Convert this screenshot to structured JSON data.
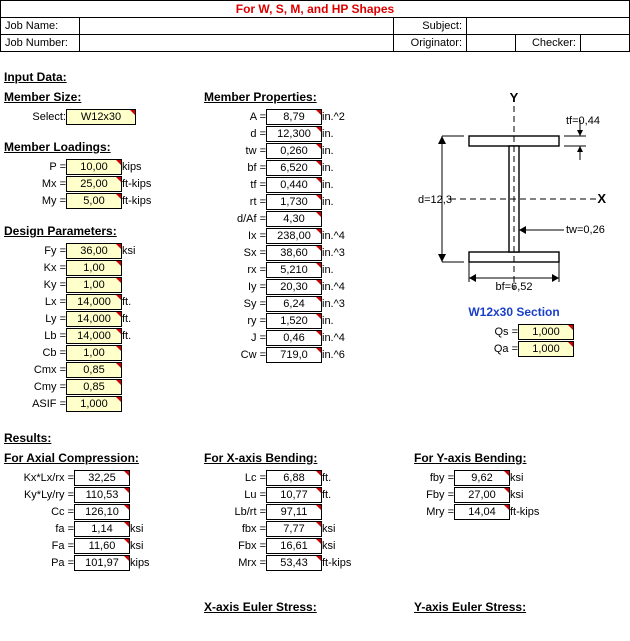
{
  "header": {
    "title": "For W, S, M, and HP Shapes",
    "labels": {
      "job_name": "Job Name:",
      "job_number": "Job Number:",
      "subject": "Subject:",
      "originator": "Originator:",
      "checker": "Checker:"
    },
    "values": {
      "job_name": "",
      "job_number": "",
      "subject": "",
      "originator": "",
      "checker": ""
    }
  },
  "sections": {
    "input_data": "Input Data:",
    "results": "Results:"
  },
  "member_size_head": "Member Size:",
  "member_size": {
    "label": "Select:",
    "value": "W12x30"
  },
  "member_loadings_head": "Member Loadings:",
  "loadings": [
    {
      "label": "P =",
      "value": "10,00",
      "unit": "kips"
    },
    {
      "label": "Mx =",
      "value": "25,00",
      "unit": "ft-kips"
    },
    {
      "label": "My =",
      "value": "5,00",
      "unit": "ft-kips"
    }
  ],
  "design_params_head": "Design Parameters:",
  "design_params": [
    {
      "label": "Fy =",
      "value": "36,00",
      "unit": "ksi"
    },
    {
      "label": "Kx =",
      "value": "1,00",
      "unit": ""
    },
    {
      "label": "Ky =",
      "value": "1,00",
      "unit": ""
    },
    {
      "label": "Lx =",
      "value": "14,000",
      "unit": "ft."
    },
    {
      "label": "Ly =",
      "value": "14,000",
      "unit": "ft."
    },
    {
      "label": "Lb =",
      "value": "14,000",
      "unit": "ft."
    },
    {
      "label": "Cb =",
      "value": "1,00",
      "unit": ""
    },
    {
      "label": "Cmx =",
      "value": "0,85",
      "unit": ""
    },
    {
      "label": "Cmy =",
      "value": "0,85",
      "unit": ""
    },
    {
      "label": "ASIF =",
      "value": "1,000",
      "unit": ""
    }
  ],
  "member_props_head": "Member Properties:",
  "member_props": [
    {
      "label": "A =",
      "value": "8,79",
      "unit": "in.^2"
    },
    {
      "label": "d =",
      "value": "12,300",
      "unit": "in."
    },
    {
      "label": "tw =",
      "value": "0,260",
      "unit": "in."
    },
    {
      "label": "bf =",
      "value": "6,520",
      "unit": "in."
    },
    {
      "label": "tf =",
      "value": "0,440",
      "unit": "in."
    },
    {
      "label": "rt =",
      "value": "1,730",
      "unit": "in."
    },
    {
      "label": "d/Af =",
      "value": "4,30",
      "unit": ""
    },
    {
      "label": "Ix =",
      "value": "238,00",
      "unit": "in.^4"
    },
    {
      "label": "Sx =",
      "value": "38,60",
      "unit": "in.^3"
    },
    {
      "label": "rx =",
      "value": "5,210",
      "unit": "in."
    },
    {
      "label": "Iy =",
      "value": "20,30",
      "unit": "in.^4"
    },
    {
      "label": "Sy =",
      "value": "6,24",
      "unit": "in.^3"
    },
    {
      "label": "ry =",
      "value": "1,520",
      "unit": "in."
    },
    {
      "label": "J =",
      "value": "0,46",
      "unit": "in.^4"
    },
    {
      "label": "Cw =",
      "value": "719,0",
      "unit": "in.^6"
    }
  ],
  "diagram": {
    "axis_y": "Y",
    "axis_x": "X",
    "tf": "tf=0,44",
    "tw": "tw=0,26",
    "d": "d=12,3",
    "bf": "bf=6,52",
    "section": "W12x30 Section"
  },
  "q": [
    {
      "label": "Qs =",
      "value": "1,000"
    },
    {
      "label": "Qa =",
      "value": "1,000"
    }
  ],
  "axial_head": "For Axial Compression:",
  "axial": [
    {
      "label": "Kx*Lx/rx =",
      "value": "32,25",
      "unit": ""
    },
    {
      "label": "Ky*Ly/ry =",
      "value": "110,53",
      "unit": ""
    },
    {
      "label": "Cc =",
      "value": "126,10",
      "unit": ""
    },
    {
      "label": "fa =",
      "value": "1,14",
      "unit": "ksi"
    },
    {
      "label": "Fa =",
      "value": "11,60",
      "unit": "ksi"
    },
    {
      "label": "Pa =",
      "value": "101,97",
      "unit": "kips"
    }
  ],
  "xbend_head": "For X-axis Bending:",
  "xbend": [
    {
      "label": "Lc =",
      "value": "6,88",
      "unit": "ft."
    },
    {
      "label": "Lu =",
      "value": "10,77",
      "unit": "ft."
    },
    {
      "label": "Lb/rt =",
      "value": "97,11",
      "unit": ""
    },
    {
      "label": "fbx =",
      "value": "7,77",
      "unit": "ksi"
    },
    {
      "label": "Fbx =",
      "value": "16,61",
      "unit": "ksi"
    },
    {
      "label": "Mrx =",
      "value": "53,43",
      "unit": "ft-kips"
    }
  ],
  "ybend_head": "For Y-axis Bending:",
  "ybend": [
    {
      "label": "fby =",
      "value": "9,62",
      "unit": "ksi"
    },
    {
      "label": "Fby =",
      "value": "27,00",
      "unit": "ksi"
    },
    {
      "label": "Mry =",
      "value": "14,04",
      "unit": "ft-kips"
    }
  ],
  "x_euler_head": "X-axis Euler Stress:",
  "y_euler_head": "Y-axis Euler Stress:"
}
